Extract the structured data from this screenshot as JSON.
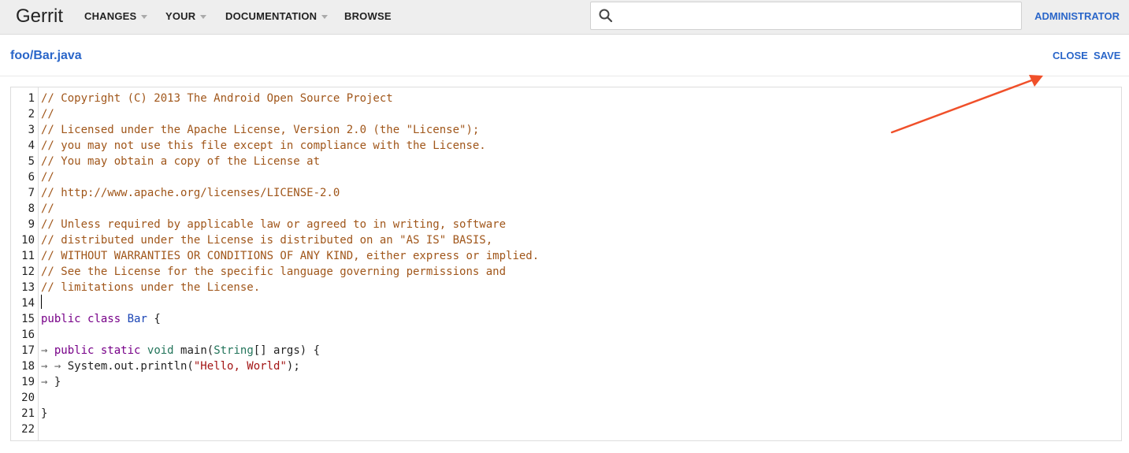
{
  "header": {
    "brand": "Gerrit",
    "menus": [
      "CHANGES",
      "YOUR",
      "DOCUMENTATION",
      "BROWSE"
    ],
    "search": {
      "value": "",
      "placeholder": ""
    },
    "user": "ADMINISTRATOR"
  },
  "file": {
    "path": "foo/Bar.java",
    "close_label": "CLOSE",
    "save_label": "SAVE"
  },
  "editor": {
    "line_numbers": [
      "1",
      "2",
      "3",
      "4",
      "5",
      "6",
      "7",
      "8",
      "9",
      "10",
      "11",
      "12",
      "13",
      "14",
      "15",
      "16",
      "17",
      "18",
      "19",
      "20",
      "21",
      "22"
    ],
    "comment_lines": [
      "// Copyright (C) 2013 The Android Open Source Project",
      "//",
      "// Licensed under the Apache License, Version 2.0 (the \"License\");",
      "// you may not use this file except in compliance with the License.",
      "// You may obtain a copy of the License at",
      "//",
      "// http://www.apache.org/licenses/LICENSE-2.0",
      "//",
      "// Unless required by applicable law or agreed to in writing, software",
      "// distributed under the License is distributed on an \"AS IS\" BASIS,",
      "// WITHOUT WARRANTIES OR CONDITIONS OF ANY KIND, either express or implied.",
      "// See the License for the specific language governing permissions and",
      "// limitations under the License."
    ],
    "tokens": {
      "public": "public",
      "class": "class",
      "bar": "Bar",
      "open_brace": " {",
      "static": "static",
      "void": "void",
      "main": " main(",
      "string": "String",
      "args": "[] args) {",
      "tab": "→ ",
      "println": "System.out.println(",
      "hello": "\"Hello, World\"",
      "println_end": ");",
      "close_brace": "}"
    }
  }
}
